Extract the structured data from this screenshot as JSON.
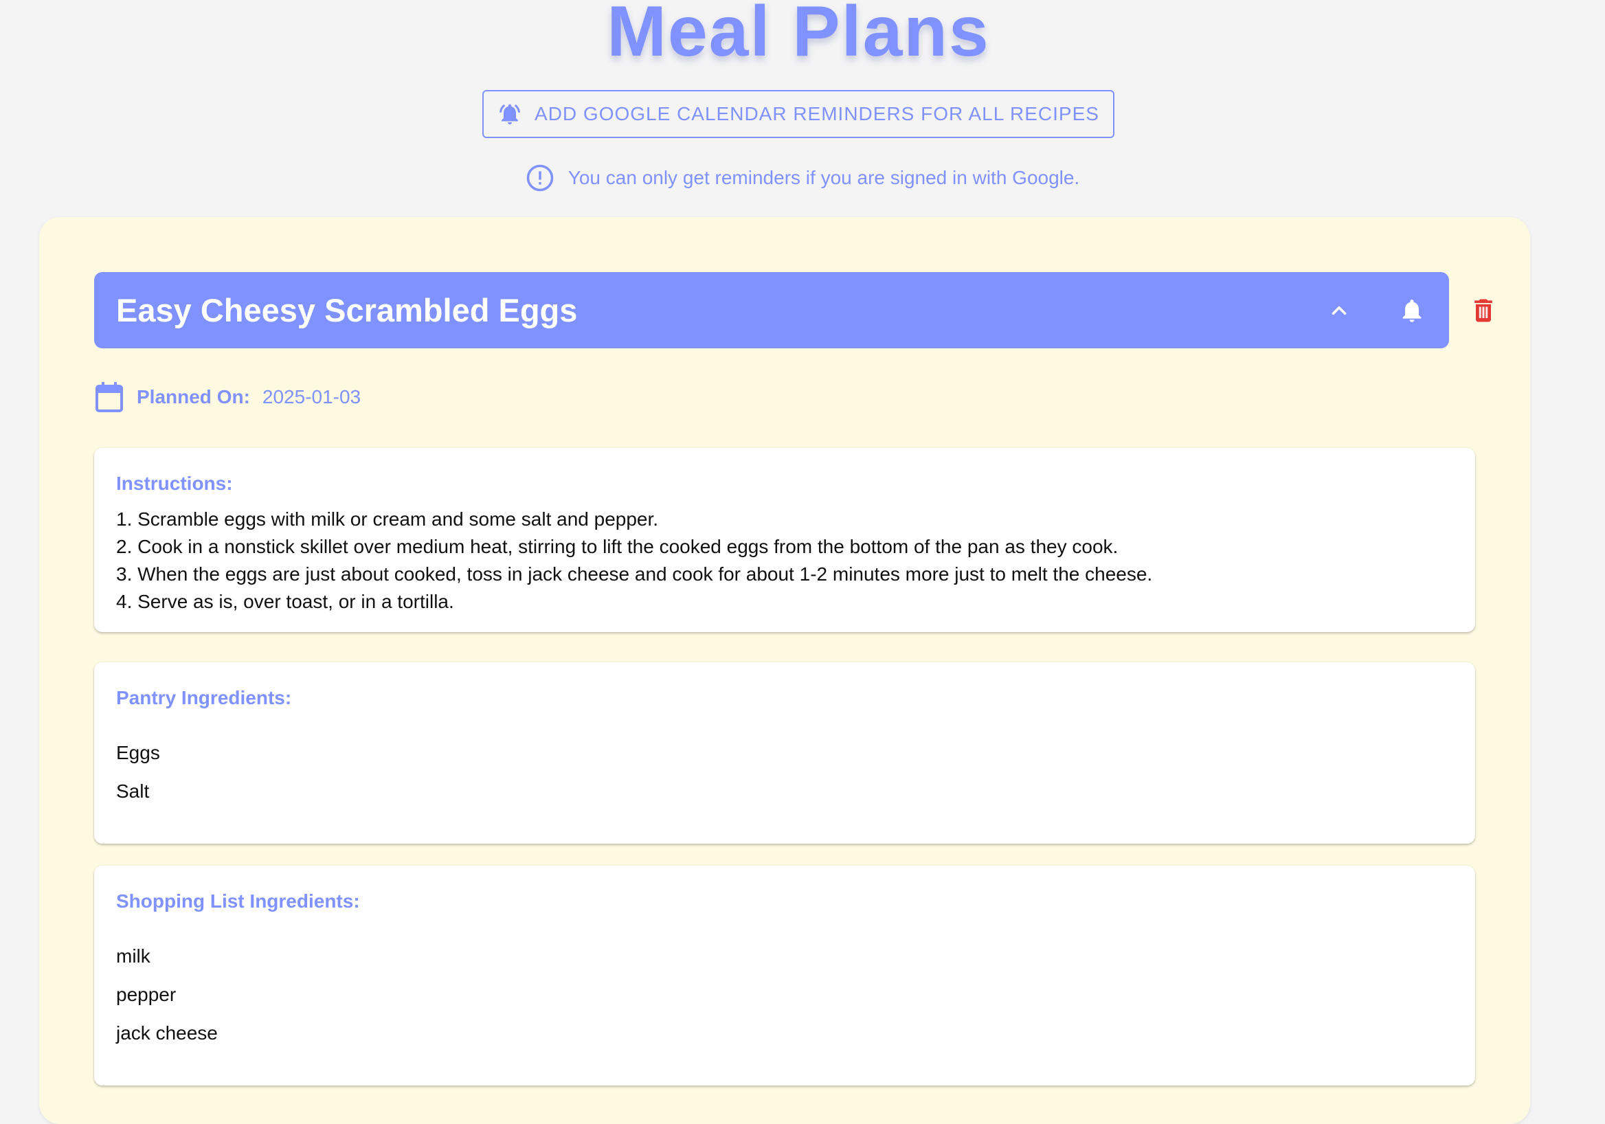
{
  "page": {
    "title": "Meal Plans",
    "reminder_button_label": "ADD GOOGLE CALENDAR REMINDERS FOR ALL RECIPES",
    "signin_note": "You can only get reminders if you are signed in with Google."
  },
  "recipe": {
    "title": "Easy Cheesy Scrambled Eggs",
    "planned_label": "Planned On:",
    "planned_date": "2025-01-03",
    "instructions_heading": "Instructions:",
    "instructions": [
      "1. Scramble eggs with milk or cream and some salt and pepper.",
      "2. Cook in a nonstick skillet over medium heat, stirring to lift the cooked eggs from the bottom of the pan as they cook.",
      "3. When the eggs are just about cooked, toss in jack cheese and cook for about 1-2 minutes more just to melt the cheese.",
      "4. Serve as is, over toast, or in a tortilla."
    ],
    "pantry_heading": "Pantry Ingredients:",
    "pantry_ingredients": [
      "Eggs",
      "Salt"
    ],
    "shopping_heading": "Shopping List Ingredients:",
    "shopping_ingredients": [
      "milk",
      "pepper",
      "jack cheese"
    ]
  },
  "icons": {
    "reminder_button": "alarm-bell-icon",
    "signin_note": "info-circle-icon",
    "collapse": "chevron-up-icon",
    "reminder": "bell-icon",
    "delete": "trash-icon",
    "planned": "calendar-icon"
  },
  "colors": {
    "accent": "#7f92ff",
    "panel_background": "#fef9e1",
    "delete": "#e53935",
    "page_background": "#f4f4f5"
  }
}
